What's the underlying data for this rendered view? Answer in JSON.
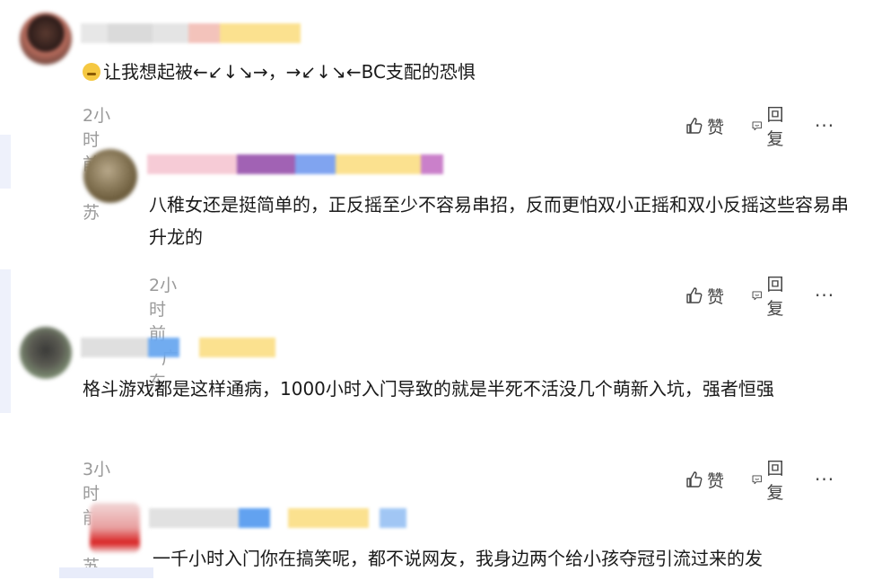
{
  "comments": [
    {
      "emoji": "laughing-crying",
      "text": "让我想起被←↙↓↘→，→↙↓↘←BC支配的恐惧",
      "time": "2小时前",
      "location": "江苏",
      "like_label": "赞",
      "reply_label": "回复",
      "more": "···"
    },
    {
      "text": "八稚女还是挺简单的，正反摇至少不容易串招，反而更怕双小正摇和双小反摇这些容易串升龙的",
      "time": "2小时前",
      "location": "广东",
      "like_label": "赞",
      "reply_label": "回复",
      "more": "···"
    },
    {
      "text": "格斗游戏都是这样通病，1000小时入门导致的就是半死不活没几个萌新入坑，强者恒强",
      "time": "3小时前",
      "location": "江苏",
      "like_label": "赞",
      "reply_label": "回复",
      "more": "···"
    },
    {
      "text": "一千小时入门你在搞笑呢，都不说网友，我身边两个给小孩夺冠引流过来的发"
    }
  ],
  "colors": {
    "text": "#1a1a1a",
    "meta": "#9a9a9a",
    "action": "#444444",
    "accent_bg": "#eef1fb"
  }
}
